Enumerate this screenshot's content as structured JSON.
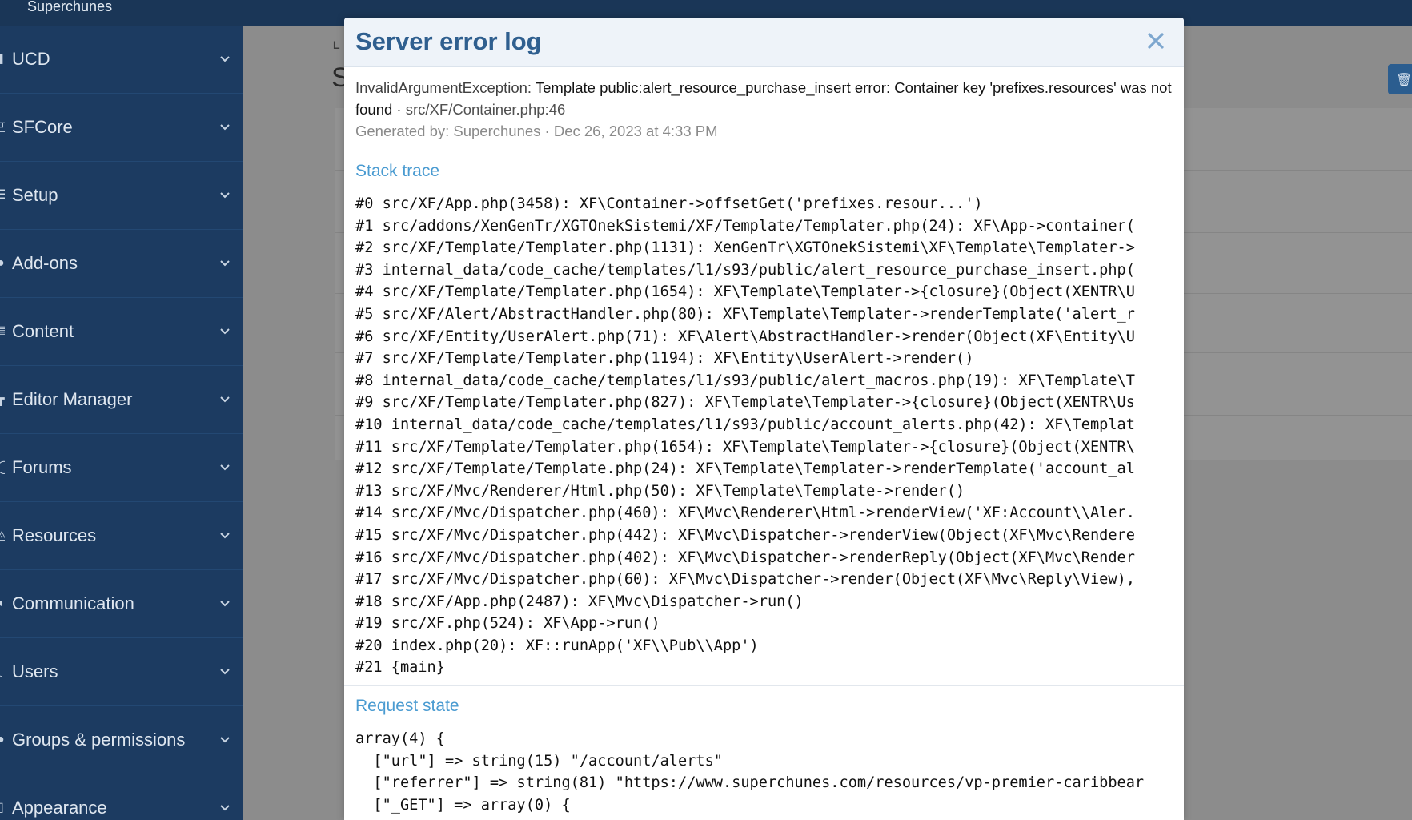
{
  "header": {
    "site_name": "Superchunes"
  },
  "sidebar": {
    "items": [
      {
        "label": "UCD",
        "icon": "book-icon"
      },
      {
        "label": "SFCore",
        "icon": "core-icon"
      },
      {
        "label": "Setup",
        "icon": "list-icon"
      },
      {
        "label": "Add-ons",
        "icon": "puzzle-icon"
      },
      {
        "label": "Content",
        "icon": "content-icon"
      },
      {
        "label": "Editor Manager",
        "icon": "editor-icon"
      },
      {
        "label": "Forums",
        "icon": "forum-icon"
      },
      {
        "label": "Resources",
        "icon": "resources-icon"
      },
      {
        "label": "Communication",
        "icon": "communication-icon"
      },
      {
        "label": "Users",
        "icon": "users-icon"
      },
      {
        "label": "Groups & permissions",
        "icon": "groups-icon"
      },
      {
        "label": "Appearance",
        "icon": "appearance-icon"
      }
    ]
  },
  "background": {
    "breadcrumb_fragment": "L",
    "title_fragment": "S",
    "trash_icon": "trash-icon"
  },
  "modal": {
    "title": "Server error log",
    "close_icon": "close-icon",
    "error_type": "InvalidArgumentException:",
    "error_message": "Template public:alert_resource_purchase_insert error: Container key 'prefixes.resources' was not found",
    "error_separator": " · ",
    "error_file": "src/XF/Container.php:46",
    "generated_by": "Generated by: Superchunes · Dec 26, 2023 at 4:33 PM",
    "stack_trace_heading": "Stack trace",
    "stack_trace": [
      "#0 src/XF/App.php(3458): XF\\Container->offsetGet('prefixes.resour...')",
      "#1 src/addons/XenGenTr/XGTOnekSistemi/XF/Template/Templater.php(24): XF\\App->container(",
      "#2 src/XF/Template/Templater.php(1131): XenGenTr\\XGTOnekSistemi\\XF\\Template\\Templater->",
      "#3 internal_data/code_cache/templates/l1/s93/public/alert_resource_purchase_insert.php(",
      "#4 src/XF/Template/Templater.php(1654): XF\\Template\\Templater->{closure}(Object(XENTR\\U",
      "#5 src/XF/Alert/AbstractHandler.php(80): XF\\Template\\Templater->renderTemplate('alert_r",
      "#6 src/XF/Entity/UserAlert.php(71): XF\\Alert\\AbstractHandler->render(Object(XF\\Entity\\U",
      "#7 src/XF/Template/Templater.php(1194): XF\\Entity\\UserAlert->render()",
      "#8 internal_data/code_cache/templates/l1/s93/public/alert_macros.php(19): XF\\Template\\T",
      "#9 src/XF/Template/Templater.php(827): XF\\Template\\Templater->{closure}(Object(XENTR\\Us",
      "#10 internal_data/code_cache/templates/l1/s93/public/account_alerts.php(42): XF\\Templat",
      "#11 src/XF/Template/Templater.php(1654): XF\\Template\\Templater->{closure}(Object(XENTR\\",
      "#12 src/XF/Template/Template.php(24): XF\\Template\\Templater->renderTemplate('account_al",
      "#13 src/XF/Mvc/Renderer/Html.php(50): XF\\Template\\Template->render()",
      "#14 src/XF/Mvc/Dispatcher.php(460): XF\\Mvc\\Renderer\\Html->renderView('XF:Account\\\\Aler.",
      "#15 src/XF/Mvc/Dispatcher.php(442): XF\\Mvc\\Dispatcher->renderView(Object(XF\\Mvc\\Rendere",
      "#16 src/XF/Mvc/Dispatcher.php(402): XF\\Mvc\\Dispatcher->renderReply(Object(XF\\Mvc\\Render",
      "#17 src/XF/Mvc/Dispatcher.php(60): XF\\Mvc\\Dispatcher->render(Object(XF\\Mvc\\Reply\\View),",
      "#18 src/XF/App.php(2487): XF\\Mvc\\Dispatcher->run()",
      "#19 src/XF.php(524): XF\\App->run()",
      "#20 index.php(20): XF::runApp('XF\\\\Pub\\\\App')",
      "#21 {main}"
    ],
    "request_state_heading": "Request state",
    "request_state": [
      "array(4) {",
      "  [\"url\"] => string(15) \"/account/alerts\"",
      "  [\"referrer\"] => string(81) \"https://www.superchunes.com/resources/vp-premier-caribbear",
      "  [\"_GET\"] => array(0) {"
    ]
  },
  "colors": {
    "sidebar_bg": "#1c3b61",
    "topbar_bg": "#1a3657",
    "modal_title": "#2f5f8f",
    "section_heading": "#4a9bd1"
  }
}
